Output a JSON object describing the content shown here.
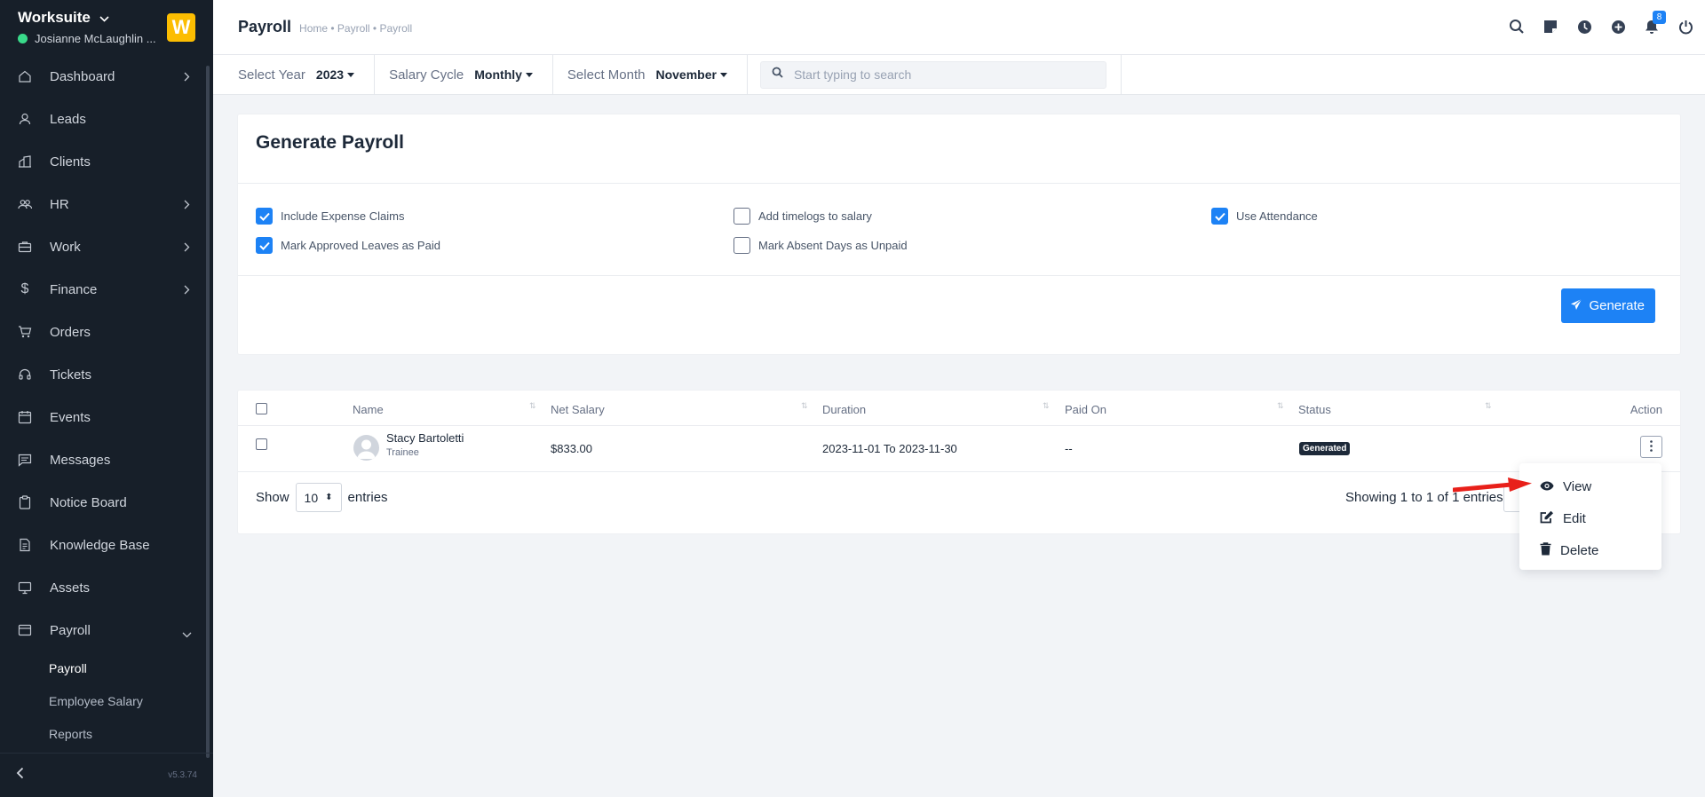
{
  "app": {
    "name": "Worksuite",
    "user": "Josianne McLaughlin ...",
    "logo_letter": "W",
    "version": "v5.3.74"
  },
  "sidebar": {
    "items": [
      {
        "label": "Dashboard",
        "icon": "home-icon",
        "has_children": true
      },
      {
        "label": "Leads",
        "icon": "user-icon",
        "has_children": false
      },
      {
        "label": "Clients",
        "icon": "building-icon",
        "has_children": false
      },
      {
        "label": "HR",
        "icon": "people-icon",
        "has_children": true
      },
      {
        "label": "Work",
        "icon": "briefcase-icon",
        "has_children": true
      },
      {
        "label": "Finance",
        "icon": "dollar-icon",
        "has_children": true
      },
      {
        "label": "Orders",
        "icon": "cart-icon",
        "has_children": false
      },
      {
        "label": "Tickets",
        "icon": "headset-icon",
        "has_children": false
      },
      {
        "label": "Events",
        "icon": "calendar-icon",
        "has_children": false
      },
      {
        "label": "Messages",
        "icon": "chat-icon",
        "has_children": false
      },
      {
        "label": "Notice Board",
        "icon": "clipboard-icon",
        "has_children": false
      },
      {
        "label": "Knowledge Base",
        "icon": "document-icon",
        "has_children": false
      },
      {
        "label": "Assets",
        "icon": "monitor-icon",
        "has_children": false
      },
      {
        "label": "Payroll",
        "icon": "payroll-icon",
        "has_children": true,
        "expanded": true
      }
    ],
    "payroll_sub": [
      "Payroll",
      "Employee Salary",
      "Reports"
    ]
  },
  "header": {
    "title": "Payroll",
    "breadcrumb": "Home • Payroll • Payroll",
    "notification_count": "8"
  },
  "filters": {
    "year_label": "Select Year",
    "year_value": "2023",
    "cycle_label": "Salary Cycle",
    "cycle_value": "Monthly",
    "month_label": "Select Month",
    "month_value": "November",
    "search_placeholder": "Start typing to search"
  },
  "generate": {
    "title": "Generate Payroll",
    "options": [
      {
        "label": "Include Expense Claims",
        "checked": true
      },
      {
        "label": "Mark Approved Leaves as Paid",
        "checked": true
      },
      {
        "label": "Add timelogs to salary",
        "checked": false
      },
      {
        "label": "Mark Absent Days as Unpaid",
        "checked": false
      },
      {
        "label": "Use Attendance",
        "checked": true
      }
    ],
    "button_label": "Generate"
  },
  "table": {
    "columns": [
      "Name",
      "Net Salary",
      "Duration",
      "Paid On",
      "Status",
      "Action"
    ],
    "rows": [
      {
        "name": "Stacy Bartoletti",
        "designation": "Trainee",
        "net_salary": "$833.00",
        "duration": "2023-11-01 To 2023-11-30",
        "paid_on": "--",
        "status": "Generated"
      }
    ],
    "show_label": "Show",
    "entries_value": "10",
    "entries_label": "entries",
    "info": "Showing 1 to 1 of 1 entries"
  },
  "action_menu": {
    "items": [
      "View",
      "Edit",
      "Delete"
    ]
  },
  "colors": {
    "accent": "#1d82f5",
    "sidebar_bg": "#171f29",
    "arrow": "#e8201a"
  }
}
